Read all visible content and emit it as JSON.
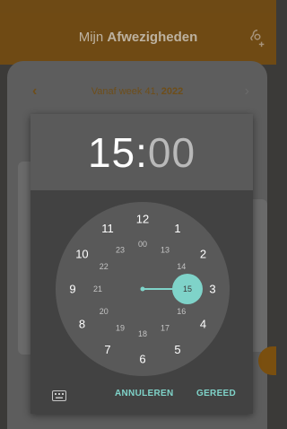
{
  "statusbar": {
    "text": ""
  },
  "appbar": {
    "title_prefix": "Mijn",
    "title_bold": "Afwezigheden",
    "icon": "settings-gear-icon"
  },
  "weeknav": {
    "label": "Vanaf week 41,",
    "year": "2022"
  },
  "time_picker": {
    "hours": "15",
    "colon": ":",
    "minutes": "00",
    "selected_hour": "15",
    "outer_hours": [
      "12",
      "1",
      "2",
      "3",
      "4",
      "5",
      "6",
      "7",
      "8",
      "9",
      "10",
      "11"
    ],
    "inner_hours": [
      "00",
      "13",
      "14",
      "15",
      "16",
      "17",
      "18",
      "19",
      "20",
      "21",
      "22",
      "23"
    ],
    "cancel_label": "ANNULEREN",
    "ok_label": "GEREED",
    "accent": "#7fd3c9"
  }
}
